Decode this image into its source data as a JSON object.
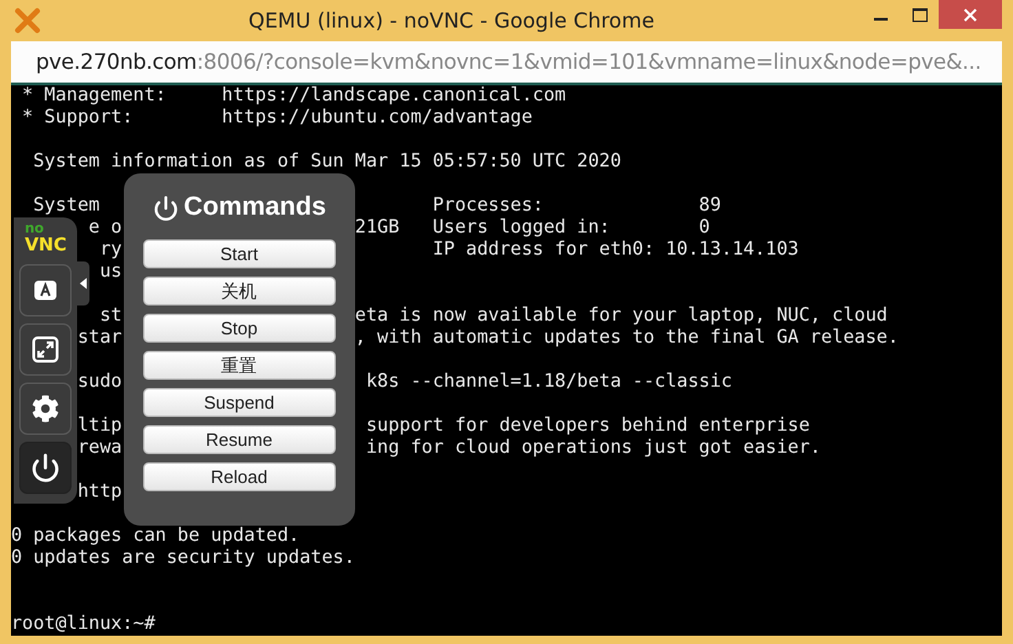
{
  "window": {
    "title": "QEMU (linux) - noVNC - Google Chrome"
  },
  "address_bar": {
    "host": "pve.270nb.com",
    "rest": ":8006/?console=kvm&novnc=1&vmid=101&vmname=linux&node=pve&..."
  },
  "terminal": {
    "lines": [
      {
        "kind": "text",
        "text": " * Management:     https://landscape.canonical.com"
      },
      {
        "kind": "text",
        "text": " * Support:        https://ubuntu.com/advantage"
      },
      {
        "kind": "blank"
      },
      {
        "kind": "text",
        "text": "  System information as of Sun Mar 15 05:57:50 UTC 2020"
      },
      {
        "kind": "blank"
      },
      {
        "kind": "split",
        "left": "  System",
        "right": "       Processes:              89"
      },
      {
        "kind": "split",
        "left": "e o",
        "right": "21GB   Users logged in:        0"
      },
      {
        "kind": "split",
        "left": "ry",
        "right": "       IP address for eth0: 10.13.14.103"
      },
      {
        "kind": "split",
        "left": "us"
      },
      {
        "kind": "blank"
      },
      {
        "kind": "split",
        "left": "st",
        "right": "eta is now available for your laptop, NUC, cloud"
      },
      {
        "kind": "split",
        "left": "star",
        "right": ", with automatic updates to the final GA release."
      },
      {
        "kind": "blank"
      },
      {
        "kind": "split",
        "left": "sudo",
        "right": " k8s --channel=1.18/beta --classic"
      },
      {
        "kind": "blank"
      },
      {
        "kind": "split",
        "left": "ltip",
        "right": " support for developers behind enterprise"
      },
      {
        "kind": "split",
        "left": "rewa",
        "right": " ing for cloud operations just got easier."
      },
      {
        "kind": "blank"
      },
      {
        "kind": "split",
        "left": "http"
      },
      {
        "kind": "blank"
      },
      {
        "kind": "text",
        "text": "0 packages can be updated."
      },
      {
        "kind": "text",
        "text": "0 updates are security updates."
      },
      {
        "kind": "blank"
      },
      {
        "kind": "blank"
      },
      {
        "kind": "text",
        "text": "root@linux:~#"
      }
    ]
  },
  "sidebar": {
    "logo": {
      "top": "no",
      "bottom": "VNC"
    },
    "buttons": [
      {
        "kind": "keyboard",
        "selected": false
      },
      {
        "kind": "fullscreen",
        "selected": false
      },
      {
        "kind": "settings",
        "selected": false
      },
      {
        "kind": "power",
        "selected": true
      }
    ]
  },
  "commands_panel": {
    "title": "Commands",
    "buttons": [
      "Start",
      "关机",
      "Stop",
      "重置",
      "Suspend",
      "Resume",
      "Reload"
    ]
  }
}
